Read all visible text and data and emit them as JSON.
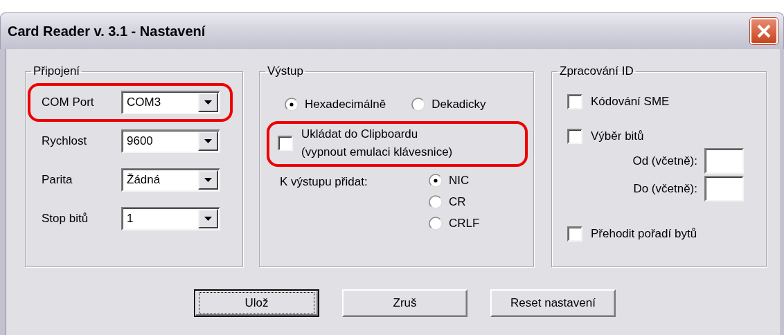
{
  "window": {
    "title": "Card Reader v. 3.1 - Nastavení"
  },
  "connection": {
    "title": "Připojení",
    "fields": [
      {
        "label": "COM Port",
        "value": "COM3",
        "highlighted": true
      },
      {
        "label": "Rychlost",
        "value": "9600",
        "highlighted": false
      },
      {
        "label": "Parita",
        "value": "Žádná",
        "highlighted": false
      },
      {
        "label": "Stop bitů",
        "value": "1",
        "highlighted": false
      }
    ]
  },
  "output": {
    "title": "Výstup",
    "format": [
      {
        "label": "Hexadecimálně",
        "selected": true
      },
      {
        "label": "Dekadicky",
        "selected": false
      }
    ],
    "clipboard": {
      "lines": [
        "Ukládat do Clipboardu",
        "(vypnout emulaci klávesnice)"
      ],
      "checked": false,
      "highlighted": true
    },
    "suffix_label": "K výstupu přidat:",
    "suffix": [
      {
        "label": "NIC",
        "selected": true
      },
      {
        "label": "CR",
        "selected": false
      },
      {
        "label": "CRLF",
        "selected": false
      }
    ]
  },
  "id_processing": {
    "title": "Zpracování ID",
    "items": [
      {
        "kind": "checkbox",
        "label": "Kódování SME",
        "checked": false
      },
      {
        "kind": "checkbox",
        "label": "Výběr bitů",
        "checked": false
      },
      {
        "kind": "range",
        "label": "Od (včetně):"
      },
      {
        "kind": "range",
        "label": "Do (včetně):"
      },
      {
        "kind": "checkbox",
        "label": "Přehodit pořadí bytů",
        "checked": false
      }
    ]
  },
  "buttons": [
    {
      "label": "Ulož",
      "default": true
    },
    {
      "label": "Zruš",
      "default": false
    },
    {
      "label": "Reset nastavení",
      "default": false
    }
  ]
}
